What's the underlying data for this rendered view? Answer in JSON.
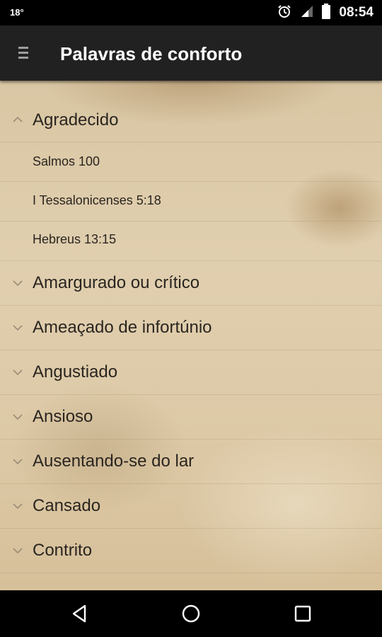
{
  "status_bar": {
    "temperature": "18°",
    "time": "08:54",
    "icons": [
      "alarm-icon",
      "signal-icon",
      "battery-icon"
    ]
  },
  "app_bar": {
    "title": "Palavras de conforto",
    "menu_icon": "menu-icon"
  },
  "list": {
    "groups": [
      {
        "label": "Agradecido",
        "expanded": true,
        "children": [
          "Salmos 100",
          "I Tessalonicenses 5:18",
          "Hebreus 13:15"
        ]
      },
      {
        "label": "Amargurado ou crítico",
        "expanded": false
      },
      {
        "label": "Ameaçado de infortúnio",
        "expanded": false
      },
      {
        "label": "Angustiado",
        "expanded": false
      },
      {
        "label": "Ansioso",
        "expanded": false
      },
      {
        "label": "Ausentando-se do lar",
        "expanded": false
      },
      {
        "label": "Cansado",
        "expanded": false
      },
      {
        "label": "Contrito",
        "expanded": false
      }
    ]
  },
  "nav_bar": {
    "buttons": [
      "back-icon",
      "home-icon",
      "recents-icon"
    ]
  },
  "colors": {
    "app_bar": "#212121",
    "text": "#2a2520",
    "paper": "#dcc8a5"
  }
}
